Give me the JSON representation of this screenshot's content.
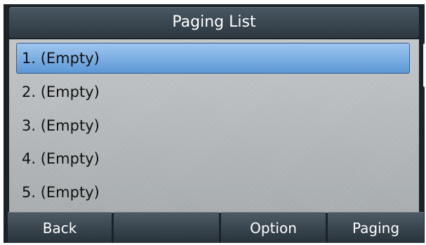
{
  "title": "Paging List",
  "list": {
    "items": [
      {
        "label": "1. (Empty)",
        "selected": true
      },
      {
        "label": "2. (Empty)"
      },
      {
        "label": "3. (Empty)"
      },
      {
        "label": "4. (Empty)"
      },
      {
        "label": "5. (Empty)"
      }
    ]
  },
  "softkeys": [
    "Back",
    "",
    "Option",
    "Paging"
  ],
  "colors": {
    "title_bar": "#2c3740",
    "selection": "#6fa6df",
    "list_background": "#b9bdbf",
    "softkey": "#35414a"
  }
}
